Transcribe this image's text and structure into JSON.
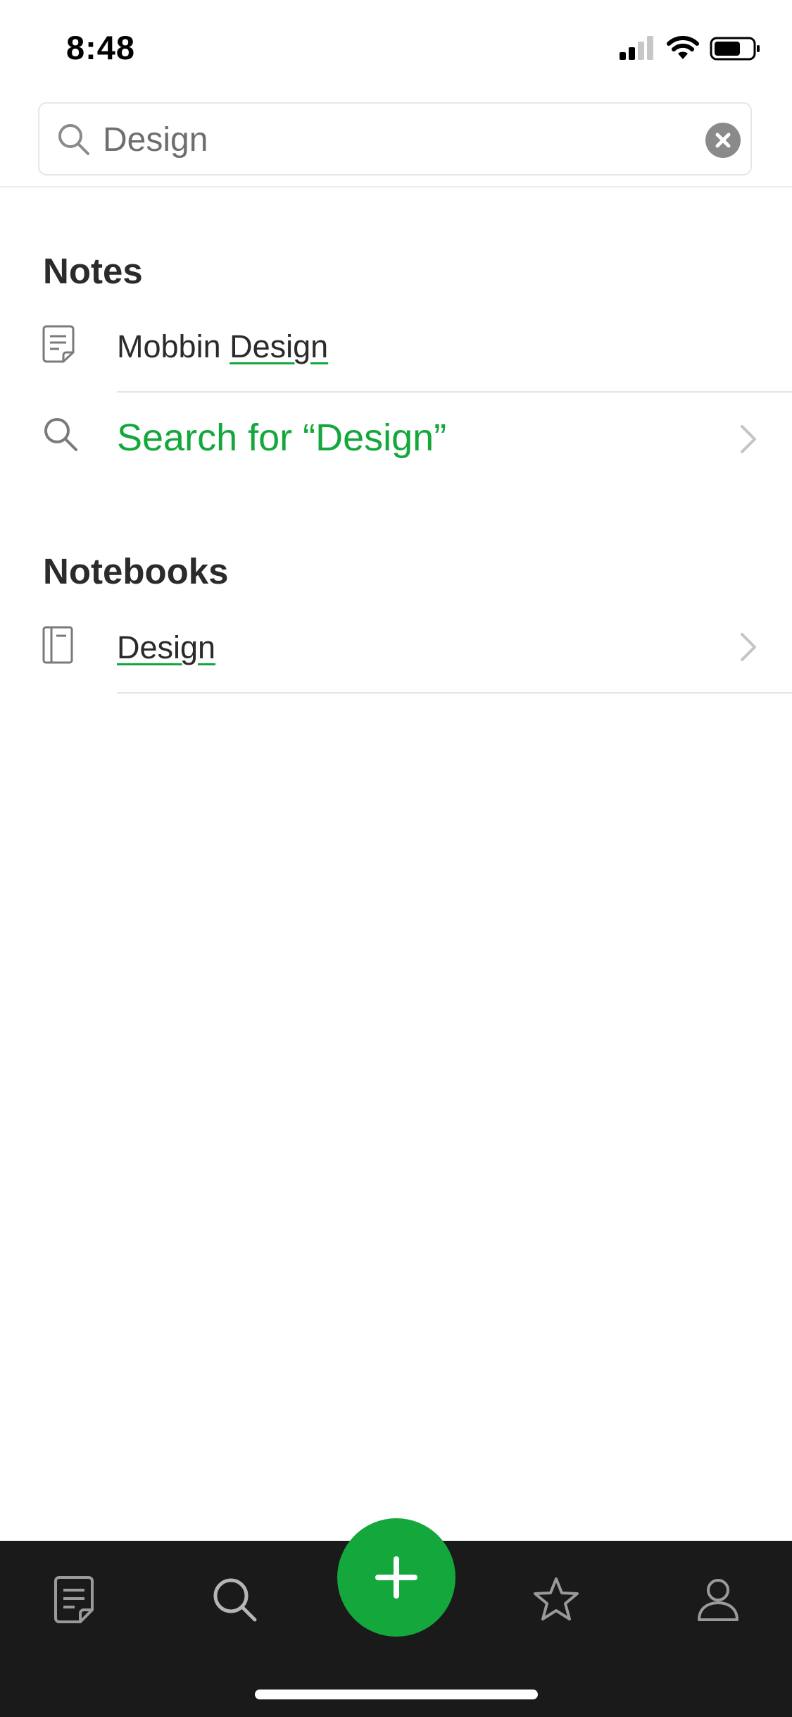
{
  "status_bar": {
    "time": "8:48"
  },
  "search": {
    "query": "Design",
    "icon": "search-icon",
    "clear_icon": "clear-icon"
  },
  "notes_section": {
    "title": "Notes",
    "items": [
      {
        "prefix": "Mobbin ",
        "match": "Design",
        "icon": "note-icon"
      }
    ],
    "search_for": {
      "label": "Search for “Design”",
      "icon": "search-icon"
    }
  },
  "notebooks_section": {
    "title": "Notebooks",
    "items": [
      {
        "match": "Design",
        "icon": "notebook-icon"
      }
    ]
  },
  "tab_bar": {
    "tabs": [
      {
        "name": "notes",
        "icon": "note-icon"
      },
      {
        "name": "search",
        "icon": "search-icon"
      },
      {
        "name": "new-note",
        "icon": "plus-icon"
      },
      {
        "name": "shortcuts",
        "icon": "star-icon"
      },
      {
        "name": "account",
        "icon": "person-icon"
      }
    ]
  },
  "colors": {
    "accent": "#14a83c",
    "tab_bar_background": "#1a1a1a",
    "text": "#2b2b2b",
    "placeholder_text": "#6e6e6e"
  }
}
